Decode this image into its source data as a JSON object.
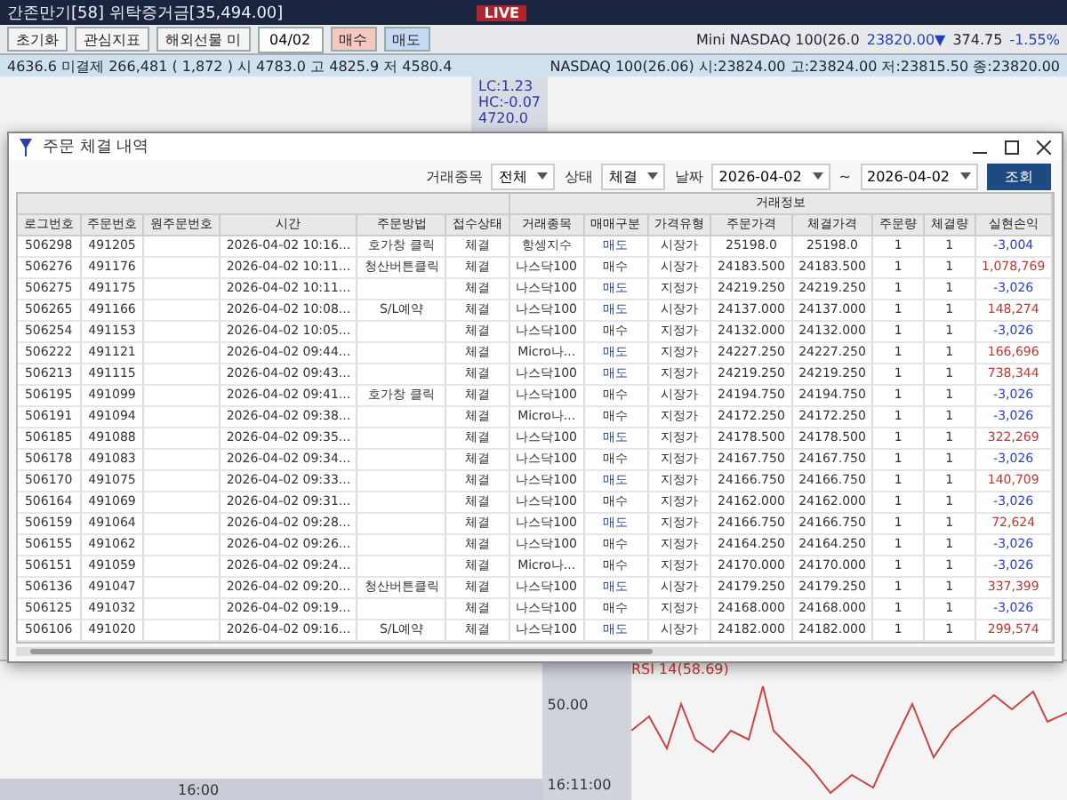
{
  "background": {
    "top_left_title": "간존만기[58] 위탁증거금[35,494.00]",
    "live_badge": "LIVE",
    "toolbar_buttons": [
      {
        "label": "초기화"
      },
      {
        "label": "관심지표"
      },
      {
        "label": "해외선물 미"
      }
    ],
    "date_field": "04/02",
    "buy_button": "매수",
    "sell_button": "매도",
    "quote_line": "4636.6 미결제 266,481 ( 1,872 ) 시 4783.0 고 4825.9 저 4580.4",
    "side_values": [
      "LC:1.23",
      "HC:-0.07",
      "4720.0"
    ],
    "right_symbol": "Mini NASDAQ 100(26.0",
    "right_price": "23820.00▼",
    "right_change": "374.75",
    "right_rate": "-1.55%",
    "right_quote": "NASDAQ 100(26.06) 시:23824.00 고:23824.00 저:23815.50 종:23820.00",
    "rsi_label": "RSI 14(58.69)",
    "axis_value": "50.00",
    "left_time": "16:00",
    "right_time": "16:11:00"
  },
  "dialog": {
    "title": "주문 체결 내역",
    "filters": [
      {
        "label": "거래종목",
        "value": "전체"
      },
      {
        "label": "상태",
        "value": "체결"
      }
    ],
    "date_label": "날짜",
    "date_from": "2026-04-02",
    "date_sep": "~",
    "date_to": "2026-04-02",
    "search_button": "조회",
    "group_header": "거래정보",
    "columns": [
      "로그번호",
      "주문번호",
      "원주문번호",
      "시간",
      "주문방법",
      "접수상태",
      "거래종목",
      "매매구분",
      "가격유형",
      "주문가격",
      "체결가격",
      "주문량",
      "체결량",
      "실현손익"
    ],
    "rows": [
      {
        "cells": [
          "506298",
          "491205",
          "",
          "2026-04-02 10:16...",
          "호가창 클릭",
          "체결",
          "항셍지수",
          "매도",
          "시장가",
          "25198.0",
          "25198.0",
          "1",
          "1",
          "-3,004"
        ],
        "kind": "sell",
        "profit": false
      },
      {
        "cells": [
          "506276",
          "491176",
          "",
          "2026-04-02 10:11...",
          "청산버튼클릭",
          "체결",
          "나스닥100",
          "매수",
          "시장가",
          "24183.500",
          "24183.500",
          "1",
          "1",
          "1,078,769"
        ],
        "kind": "buy",
        "profit": true
      },
      {
        "cells": [
          "506275",
          "491175",
          "",
          "2026-04-02 10:11...",
          "",
          "체결",
          "나스닥100",
          "매도",
          "지정가",
          "24219.250",
          "24219.250",
          "1",
          "1",
          "-3,026"
        ],
        "kind": "sell",
        "profit": false
      },
      {
        "cells": [
          "506265",
          "491166",
          "",
          "2026-04-02 10:08...",
          "S/L예약",
          "체결",
          "나스닥100",
          "매도",
          "시장가",
          "24137.000",
          "24137.000",
          "1",
          "1",
          "148,274"
        ],
        "kind": "sell",
        "profit": true
      },
      {
        "cells": [
          "506254",
          "491153",
          "",
          "2026-04-02 10:05...",
          "",
          "체결",
          "나스닥100",
          "매수",
          "지정가",
          "24132.000",
          "24132.000",
          "1",
          "1",
          "-3,026"
        ],
        "kind": "buy",
        "profit": false
      },
      {
        "cells": [
          "506222",
          "491121",
          "",
          "2026-04-02 09:44...",
          "",
          "체결",
          "Micro나...",
          "매도",
          "지정가",
          "24227.250",
          "24227.250",
          "1",
          "1",
          "166,696"
        ],
        "kind": "sell",
        "profit": true
      },
      {
        "cells": [
          "506213",
          "491115",
          "",
          "2026-04-02 09:43...",
          "",
          "체결",
          "나스닥100",
          "매도",
          "지정가",
          "24219.250",
          "24219.250",
          "1",
          "1",
          "738,344"
        ],
        "kind": "sell",
        "profit": true
      },
      {
        "cells": [
          "506195",
          "491099",
          "",
          "2026-04-02 09:41...",
          "호가창 클릭",
          "체결",
          "나스닥100",
          "매수",
          "시장가",
          "24194.750",
          "24194.750",
          "1",
          "1",
          "-3,026"
        ],
        "kind": "buy",
        "profit": false
      },
      {
        "cells": [
          "506191",
          "491094",
          "",
          "2026-04-02 09:38...",
          "",
          "체결",
          "Micro나...",
          "매수",
          "지정가",
          "24172.250",
          "24172.250",
          "1",
          "1",
          "-3,026"
        ],
        "kind": "buy",
        "profit": false
      },
      {
        "cells": [
          "506185",
          "491088",
          "",
          "2026-04-02 09:35...",
          "",
          "체결",
          "나스닥100",
          "매도",
          "지정가",
          "24178.500",
          "24178.500",
          "1",
          "1",
          "322,269"
        ],
        "kind": "sell",
        "profit": true
      },
      {
        "cells": [
          "506178",
          "491083",
          "",
          "2026-04-02 09:34...",
          "",
          "체결",
          "나스닥100",
          "매수",
          "지정가",
          "24167.750",
          "24167.750",
          "1",
          "1",
          "-3,026"
        ],
        "kind": "buy",
        "profit": false
      },
      {
        "cells": [
          "506170",
          "491075",
          "",
          "2026-04-02 09:33...",
          "",
          "체결",
          "나스닥100",
          "매도",
          "지정가",
          "24166.750",
          "24166.750",
          "1",
          "1",
          "140,709"
        ],
        "kind": "sell",
        "profit": true
      },
      {
        "cells": [
          "506164",
          "491069",
          "",
          "2026-04-02 09:31...",
          "",
          "체결",
          "나스닥100",
          "매수",
          "지정가",
          "24162.000",
          "24162.000",
          "1",
          "1",
          "-3,026"
        ],
        "kind": "buy",
        "profit": false
      },
      {
        "cells": [
          "506159",
          "491064",
          "",
          "2026-04-02 09:28...",
          "",
          "체결",
          "나스닥100",
          "매도",
          "지정가",
          "24166.750",
          "24166.750",
          "1",
          "1",
          "72,624"
        ],
        "kind": "sell",
        "profit": true
      },
      {
        "cells": [
          "506155",
          "491062",
          "",
          "2026-04-02 09:26...",
          "",
          "체결",
          "나스닥100",
          "매수",
          "지정가",
          "24164.250",
          "24164.250",
          "1",
          "1",
          "-3,026"
        ],
        "kind": "buy",
        "profit": false
      },
      {
        "cells": [
          "506151",
          "491059",
          "",
          "2026-04-02 09:24...",
          "",
          "체결",
          "Micro나...",
          "매수",
          "지정가",
          "24170.000",
          "24170.000",
          "1",
          "1",
          "-3,026"
        ],
        "kind": "buy",
        "profit": false
      },
      {
        "cells": [
          "506136",
          "491047",
          "",
          "2026-04-02 09:20...",
          "청산버튼클릭",
          "체결",
          "나스닥100",
          "매도",
          "시장가",
          "24179.250",
          "24179.250",
          "1",
          "1",
          "337,399"
        ],
        "kind": "sell",
        "profit": true
      },
      {
        "cells": [
          "506125",
          "491032",
          "",
          "2026-04-02 09:19...",
          "",
          "체결",
          "나스닥100",
          "매수",
          "지정가",
          "24168.000",
          "24168.000",
          "1",
          "1",
          "-3,026"
        ],
        "kind": "buy",
        "profit": false
      },
      {
        "cells": [
          "506106",
          "491020",
          "",
          "2026-04-02 09:16...",
          "S/L예약",
          "체결",
          "나스닥100",
          "매도",
          "시장가",
          "24182.000",
          "24182.000",
          "1",
          "1",
          "299,574"
        ],
        "kind": "sell",
        "profit": true
      }
    ]
  }
}
